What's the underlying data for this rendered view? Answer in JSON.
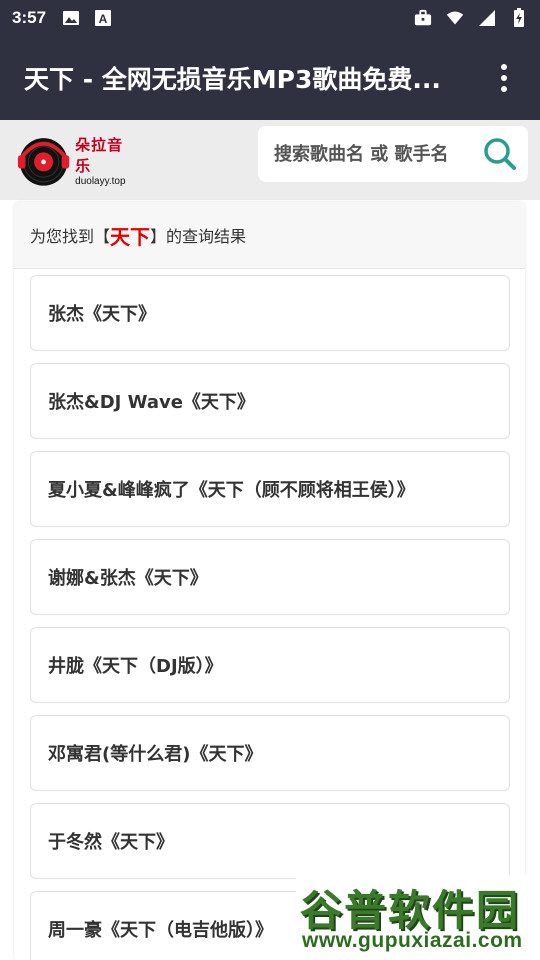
{
  "status_bar": {
    "time": "3:57",
    "left_icons": [
      "image-icon",
      "font-download-icon"
    ],
    "right_icons": [
      "briefcase-icon",
      "wifi-icon",
      "signal-icon",
      "battery-icon"
    ]
  },
  "app_bar": {
    "title": "天下 - 全网无损音乐MP3歌曲免费...",
    "menu_icon": "more-vert-icon"
  },
  "logo": {
    "name": "朵拉音乐",
    "domain": "duolayy.top"
  },
  "search": {
    "placeholder": "搜索歌曲名 或 歌手名",
    "icon": "search-icon"
  },
  "results": {
    "prefix": "为您找到【",
    "keyword": "天下",
    "suffix": "】的查询结果",
    "items": [
      "张杰《天下》",
      "张杰&DJ Wave《天下》",
      "夏小夏&峰峰疯了《天下（顾不顾将相王侯）》",
      "谢娜&张杰《天下》",
      "井胧《天下（DJ版）》",
      "邓寓君(等什么君)《天下》",
      "于冬然《天下》",
      "周一豪《天下（电吉他版）》"
    ]
  },
  "watermark": {
    "title": "谷普软件园",
    "url": "www.gupuxiazai.com"
  },
  "colors": {
    "app_bar": "#2f3040",
    "header_bg": "#ececec",
    "keyword": "#e00000",
    "search_icon": "#2a9d8f",
    "watermark": "#3b7a2a"
  }
}
